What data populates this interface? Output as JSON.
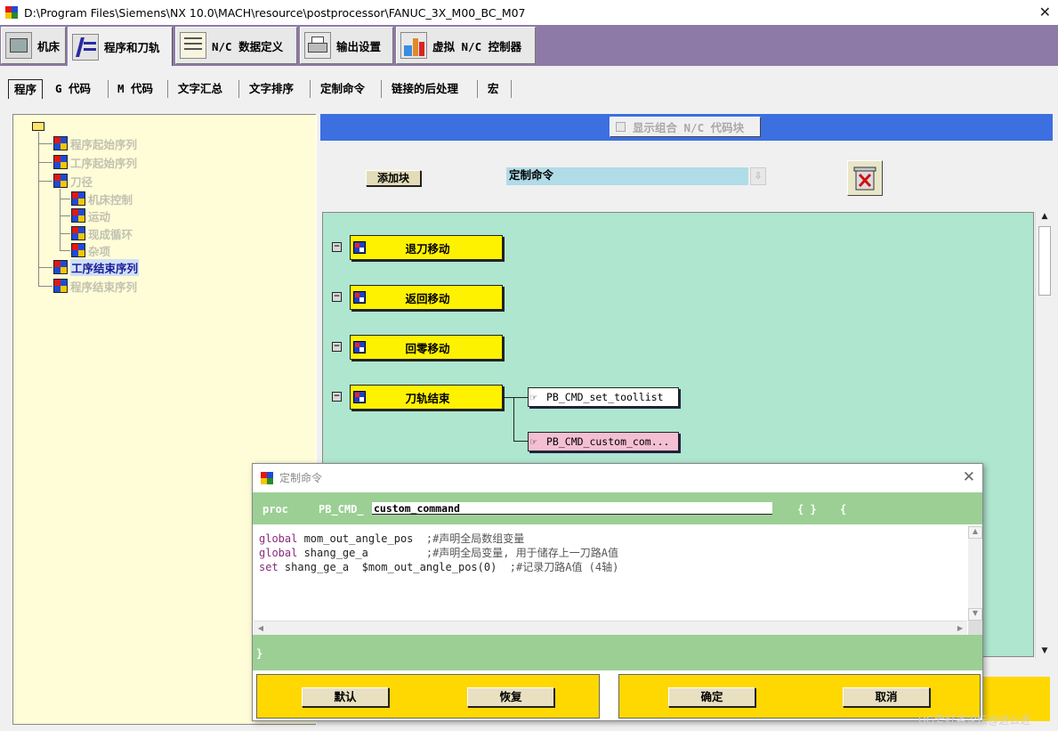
{
  "window": {
    "title": "D:\\Program Files\\Siemens\\NX 10.0\\MACH\\resource\\postprocessor\\FANUC_3X_M00_BC_M07",
    "close_glyph": "✕"
  },
  "top_tabs": [
    {
      "label": "机床",
      "icon": "machine-icon"
    },
    {
      "label": "程序和刀轨",
      "icon": "program-toolpath-icon",
      "active": true
    },
    {
      "label": "N/C 数据定义",
      "icon": "nc-data-icon"
    },
    {
      "label": "输出设置",
      "icon": "printer-icon"
    },
    {
      "label": "虚拟 N/C 控制器",
      "icon": "virtual-controller-icon"
    }
  ],
  "sub_tabs": [
    {
      "label": "程序",
      "active": true
    },
    {
      "label": "G 代码"
    },
    {
      "label": "M 代码"
    },
    {
      "label": "文字汇总"
    },
    {
      "label": "文字排序"
    },
    {
      "label": "定制命令"
    },
    {
      "label": "链接的后处理"
    },
    {
      "label": "宏"
    }
  ],
  "tree": {
    "items": [
      {
        "label": "程序起始序列",
        "selected": false
      },
      {
        "label": "工序起始序列",
        "selected": false
      },
      {
        "label": "刀径",
        "selected": false
      },
      {
        "label": "机床控制",
        "selected": false
      },
      {
        "label": "运动",
        "selected": false
      },
      {
        "label": "现成循环",
        "selected": false
      },
      {
        "label": "杂项",
        "selected": false
      },
      {
        "label": "工序结束序列",
        "selected": true
      },
      {
        "label": "程序结束序列",
        "selected": false
      }
    ]
  },
  "editor": {
    "show_combined_label": "显示组合 N/C 代码块",
    "add_block_label": "添加块",
    "command_combo_value": "定制命令",
    "combo_arrow": "⇩",
    "blocks": [
      {
        "label": "退刀移动"
      },
      {
        "label": "返回移动"
      },
      {
        "label": "回零移动"
      },
      {
        "label": "刀轨结束"
      }
    ],
    "commands": [
      {
        "label": "PB_CMD_set_toollist"
      },
      {
        "label": "PB_CMD_custom_com..."
      }
    ],
    "minus_glyph": "−",
    "hand_glyph": "☞",
    "scroll_up": "▲",
    "scroll_down": "▼"
  },
  "dialog": {
    "title": "定制命令",
    "close_glyph": "✕",
    "proc_keyword": "proc",
    "name_prefix": "PB_CMD_",
    "name_value": "custom_command",
    "brace_pair": "{ }",
    "open_brace": "{",
    "close_brace": "}",
    "code_lines": [
      {
        "kw": "global",
        "text": " mom_out_angle_pos  ",
        "comment": ";#声明全局数组变量"
      },
      {
        "kw": "global",
        "text": " shang_ge_a         ",
        "comment": ";#声明全局变量, 用于储存上一刀路A值"
      },
      {
        "kw": "set",
        "text": " shang_ge_a  $mom_out_angle_pos(0)  ",
        "comment": ";#记录刀路A值 (4轴)"
      }
    ],
    "buttons": {
      "default": "默认",
      "restore": "恢复",
      "ok": "确定",
      "cancel": "取消"
    },
    "scroll_left": "◀",
    "scroll_right": "▶",
    "scroll_up": "▲",
    "scroll_down": "▼"
  },
  "watermark": "UG爱好者论坛@这么近",
  "colors": {
    "toolbar_bg": "#8e7aa6",
    "tree_bg": "#fefdd8",
    "canvas_bg": "#aee6cf",
    "block_yellow": "#fff200",
    "dialog_green": "#9bcf94",
    "button_panel_yellow": "#fed800",
    "header_blue": "#3c6fe0"
  }
}
